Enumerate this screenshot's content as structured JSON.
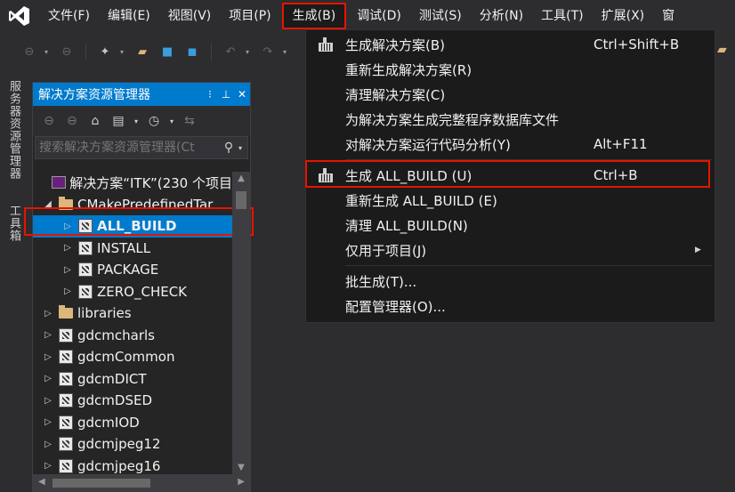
{
  "menubar": {
    "logo_icon": "visual-studio-logo-icon",
    "items": [
      {
        "label": "文件(F)"
      },
      {
        "label": "编辑(E)"
      },
      {
        "label": "视图(V)"
      },
      {
        "label": "项目(P)"
      },
      {
        "label": "生成(B)",
        "active": true
      },
      {
        "label": "调试(D)"
      },
      {
        "label": "测试(S)"
      },
      {
        "label": "分析(N)"
      },
      {
        "label": "工具(T)"
      },
      {
        "label": "扩展(X)"
      },
      {
        "label": "窗"
      }
    ]
  },
  "side_tabs": [
    "服务器资源管理器",
    "工具箱"
  ],
  "solution_explorer": {
    "title": "解决方案资源管理器",
    "search_placeholder": "搜索解决方案资源管理器(Ct",
    "tree": [
      {
        "indent": 0,
        "arrow": "",
        "icon": "solution",
        "label": "解决方案“ITK”(230 个项目"
      },
      {
        "indent": 1,
        "arrow": "◢",
        "icon": "folder",
        "label": "CMakePredefinedTar"
      },
      {
        "indent": 2,
        "arrow": "▷",
        "icon": "project",
        "label": "ALL_BUILD",
        "selected": true
      },
      {
        "indent": 2,
        "arrow": "▷",
        "icon": "project",
        "label": "INSTALL"
      },
      {
        "indent": 2,
        "arrow": "▷",
        "icon": "project",
        "label": "PACKAGE"
      },
      {
        "indent": 2,
        "arrow": "▷",
        "icon": "project",
        "label": "ZERO_CHECK"
      },
      {
        "indent": 1,
        "arrow": "▷",
        "icon": "folder",
        "label": "libraries"
      },
      {
        "indent": 1,
        "arrow": "▷",
        "icon": "project",
        "label": "gdcmcharls"
      },
      {
        "indent": 1,
        "arrow": "▷",
        "icon": "project",
        "label": "gdcmCommon"
      },
      {
        "indent": 1,
        "arrow": "▷",
        "icon": "project",
        "label": "gdcmDICT"
      },
      {
        "indent": 1,
        "arrow": "▷",
        "icon": "project",
        "label": "gdcmDSED"
      },
      {
        "indent": 1,
        "arrow": "▷",
        "icon": "project",
        "label": "gdcmIOD"
      },
      {
        "indent": 1,
        "arrow": "▷",
        "icon": "project",
        "label": "gdcmjpeg12"
      },
      {
        "indent": 1,
        "arrow": "▷",
        "icon": "project",
        "label": "gdcmjpeg16"
      }
    ]
  },
  "build_menu": {
    "items": [
      {
        "type": "item",
        "icon": "build-icon",
        "label": "生成解决方案(B)",
        "shortcut": "Ctrl+Shift+B"
      },
      {
        "type": "item",
        "icon": "",
        "label": "重新生成解决方案(R)",
        "shortcut": ""
      },
      {
        "type": "item",
        "icon": "",
        "label": "清理解决方案(C)",
        "shortcut": ""
      },
      {
        "type": "item",
        "icon": "",
        "label": "为解决方案生成完整程序数据库文件",
        "shortcut": ""
      },
      {
        "type": "item",
        "icon": "",
        "label": "对解决方案运行代码分析(Y)",
        "shortcut": "Alt+F11"
      },
      {
        "type": "sep"
      },
      {
        "type": "item",
        "icon": "build-icon",
        "label": "生成 ALL_BUILD (U)",
        "shortcut": "Ctrl+B",
        "highlight": true
      },
      {
        "type": "item",
        "icon": "",
        "label": "重新生成 ALL_BUILD (E)",
        "shortcut": ""
      },
      {
        "type": "item",
        "icon": "",
        "label": "清理 ALL_BUILD(N)",
        "shortcut": ""
      },
      {
        "type": "item",
        "icon": "",
        "label": "仅用于项目(J)",
        "shortcut": "",
        "submenu": true
      },
      {
        "type": "sep"
      },
      {
        "type": "item",
        "icon": "",
        "label": "批生成(T)...",
        "shortcut": ""
      },
      {
        "type": "item",
        "icon": "",
        "label": "配置管理器(O)...",
        "shortcut": ""
      }
    ]
  },
  "colors": {
    "accent": "#007acc",
    "highlight_box": "#e51400",
    "background": "#2d2d30"
  }
}
